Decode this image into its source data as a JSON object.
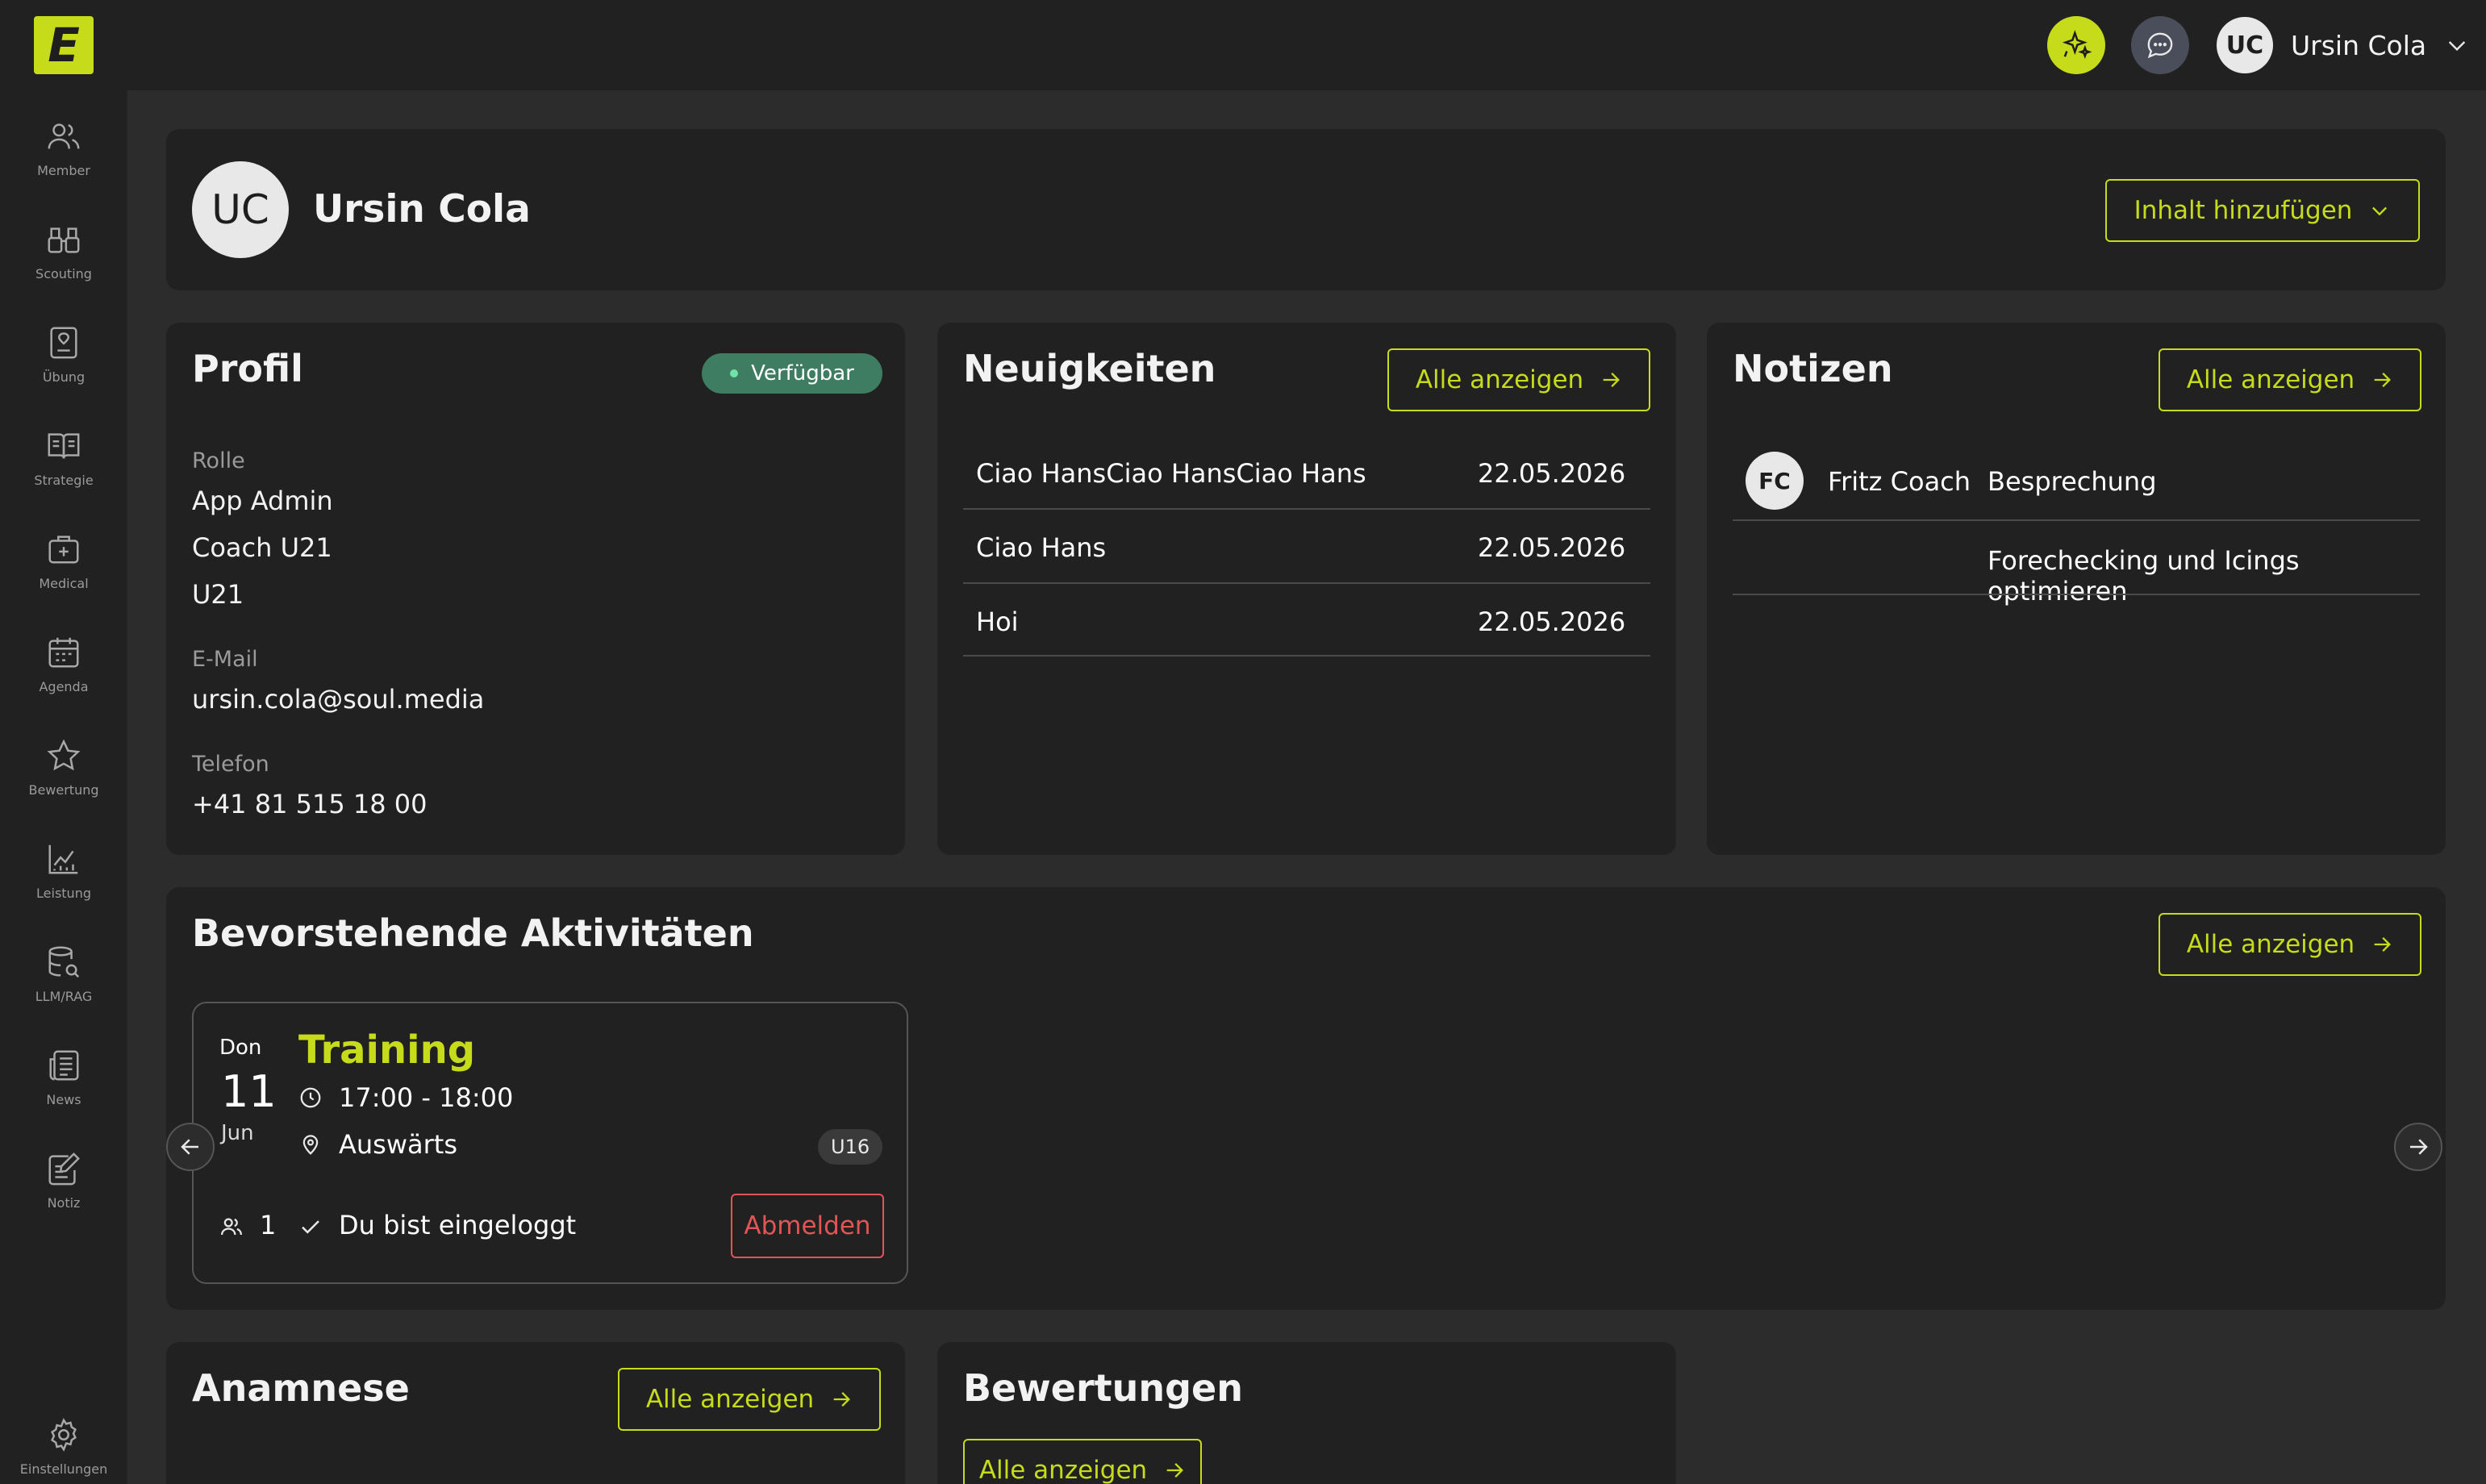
{
  "colors": {
    "accent": "#c6dc1a",
    "background": "#2c2c2c",
    "panel": "#212121",
    "status_green": "#3f7d63",
    "danger": "#e05555"
  },
  "sidebar": {
    "logo": "E",
    "items": [
      {
        "label": "Member",
        "icon": "users-icon"
      },
      {
        "label": "Scouting",
        "icon": "binoculars-icon"
      },
      {
        "label": "Übung",
        "icon": "exercise-icon"
      },
      {
        "label": "Strategie",
        "icon": "book-icon"
      },
      {
        "label": "Medical",
        "icon": "medical-kit-icon"
      },
      {
        "label": "Agenda",
        "icon": "calendar-icon"
      },
      {
        "label": "Bewertung",
        "icon": "star-icon"
      },
      {
        "label": "Leistung",
        "icon": "chart-icon"
      },
      {
        "label": "LLM/RAG",
        "icon": "database-search-icon"
      },
      {
        "label": "News",
        "icon": "newspaper-icon"
      },
      {
        "label": "Notiz",
        "icon": "note-edit-icon"
      }
    ],
    "settings_label": "Einstellungen"
  },
  "topbar": {
    "user_initials": "UC",
    "user_name": "Ursin Cola"
  },
  "header_card": {
    "initials": "UC",
    "name": "Ursin Cola",
    "add_button": "Inhalt hinzufügen"
  },
  "profil": {
    "title": "Profil",
    "status": "Verfügbar",
    "role_label": "Rolle",
    "roles": [
      "App Admin",
      "Coach U21",
      "U21"
    ],
    "email_label": "E-Mail",
    "email": "ursin.cola@soul.media",
    "phone_label": "Telefon",
    "phone": "+41 81 515 18 00"
  },
  "news": {
    "title": "Neuigkeiten",
    "button": "Alle anzeigen",
    "items": [
      {
        "title": "Ciao HansCiao HansCiao Hans",
        "date": "22.05.2026"
      },
      {
        "title": "Ciao Hans",
        "date": "22.05.2026"
      },
      {
        "title": "Hoi",
        "date": "22.05.2026"
      }
    ]
  },
  "notes": {
    "title": "Notizen",
    "button": "Alle anzeigen",
    "author_initials": "FC",
    "author": "Fritz Coach",
    "subject": "Besprechung",
    "text": "Forechecking und Icings optimieren"
  },
  "activities": {
    "title": "Bevorstehende Aktivitäten",
    "button": "Alle anzeigen",
    "event": {
      "weekday": "Don",
      "day": "11",
      "month": "Jun",
      "title": "Training",
      "time": "17:00 - 18:00",
      "location": "Auswärts",
      "team": "U16",
      "participants": "1",
      "status": "Du bist eingeloggt",
      "cancel": "Abmelden"
    }
  },
  "anamnese": {
    "title": "Anamnese",
    "button": "Alle anzeigen"
  },
  "bewertungen": {
    "title": "Bewertungen",
    "button": "Alle anzeigen"
  }
}
